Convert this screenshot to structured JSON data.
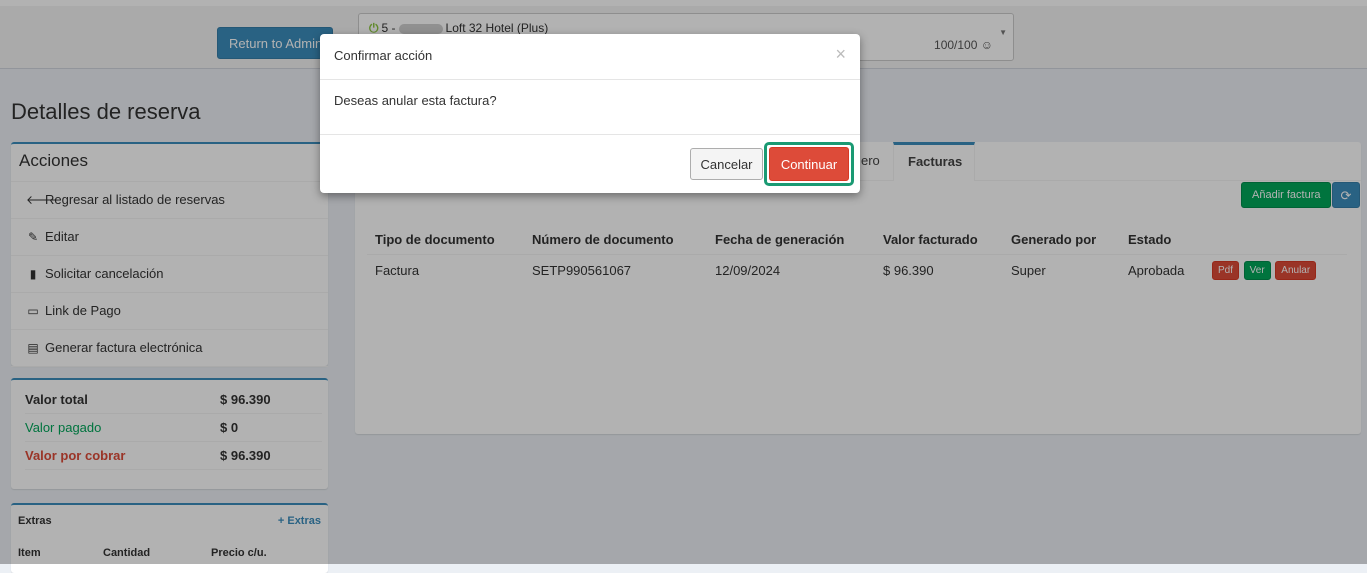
{
  "header": {
    "admin_button": "Return to Admin",
    "hotel_number": "5 -",
    "hotel_name": "Loft 32 Hotel (Plus)",
    "score": "100/100 ☺"
  },
  "page_title": "Detalles de reserva",
  "actions": {
    "title": "Acciones",
    "items": [
      {
        "icon": "arrow-left-icon",
        "label": "Regresar al listado de reservas"
      },
      {
        "icon": "pencil-icon",
        "label": "Editar"
      },
      {
        "icon": "book-icon",
        "label": "Solicitar cancelación"
      },
      {
        "icon": "credit-card-icon",
        "label": "Link de Pago"
      },
      {
        "icon": "file-icon",
        "label": "Generar factura electrónica"
      }
    ]
  },
  "totals": {
    "total_label": "Valor total",
    "total_value": "$ 96.390",
    "paid_label": "Valor pagado",
    "paid_value": "$ 0",
    "due_label": "Valor por cobrar",
    "due_value": "$ 96.390"
  },
  "extras": {
    "title": "Extras",
    "add_link": "+ Extras",
    "columns": [
      "Item",
      "Cantidad",
      "Precio c/u."
    ]
  },
  "tabs": {
    "partial_label": "ero",
    "active_label": "Facturas"
  },
  "invoices": {
    "add_button": "Añadir factura",
    "columns": [
      "Tipo de documento",
      "Número de documento",
      "Fecha de generación",
      "Valor facturado",
      "Generado por",
      "Estado"
    ],
    "rows": [
      {
        "type": "Factura",
        "number": "SETP990561067",
        "date": "12/09/2024",
        "amount": "$ 96.390",
        "generated_by": "Super",
        "status": "Aprobada",
        "btn_pdf": "Pdf",
        "btn_ver": "Ver",
        "btn_anular": "Anular"
      }
    ]
  },
  "modal": {
    "title": "Confirmar acción",
    "close": "×",
    "message": "Deseas anular esta factura?",
    "cancel": "Cancelar",
    "continue": "Continuar"
  },
  "colors": {
    "primary": "#3c8dbc",
    "success": "#00a65a",
    "danger": "#dd4b39",
    "highlight": "#1a9a73"
  }
}
